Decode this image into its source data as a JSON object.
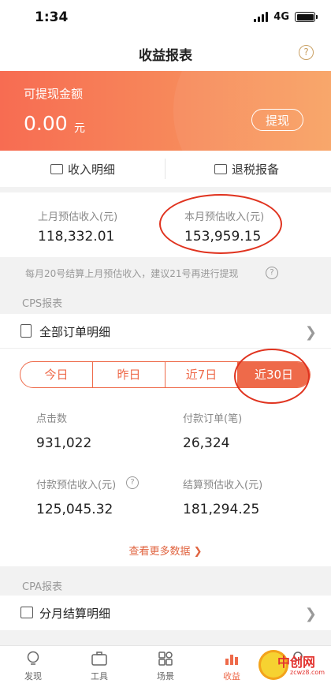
{
  "status_bar": {
    "time": "1:34",
    "network": "4G"
  },
  "nav": {
    "title": "收益报表",
    "help": "?"
  },
  "balance": {
    "label": "可提现金额",
    "amount": "0.00",
    "unit": "元",
    "withdraw_label": "提现"
  },
  "shortcuts": {
    "income_detail": "收入明细",
    "tax_filing": "退税报备"
  },
  "estimates": {
    "last_month_label": "上月预估收入(元)",
    "last_month_value": "118,332.01",
    "this_month_label": "本月预估收入(元)",
    "this_month_value": "153,959.15",
    "settle_note": "每月20号结算上月预估收入，建议21号再进行提现"
  },
  "cps": {
    "section_title": "CPS报表",
    "order_detail_label": "全部订单明细",
    "tabs": [
      "今日",
      "昨日",
      "近7日",
      "近30日"
    ],
    "active_tab": "近30日",
    "clicks_label": "点击数",
    "clicks_value": "931,022",
    "paid_orders_label": "付款订单(笔)",
    "paid_orders_value": "26,324",
    "paid_est_label": "付款预估收入(元)",
    "paid_est_value": "125,045.32",
    "settled_est_label": "结算预估收入(元)",
    "settled_est_value": "181,294.25",
    "more_link": "查看更多数据 ❯"
  },
  "cpa": {
    "section_title": "CPA报表",
    "monthly_label": "分月结算明细"
  },
  "tabbar": [
    "发现",
    "工具",
    "场景",
    "收益",
    ""
  ],
  "watermark": {
    "text": "中创网",
    "sub": "zcwz8.com"
  },
  "colors": {
    "accent": "#ee6a4a",
    "annotation": "#e0331f"
  }
}
